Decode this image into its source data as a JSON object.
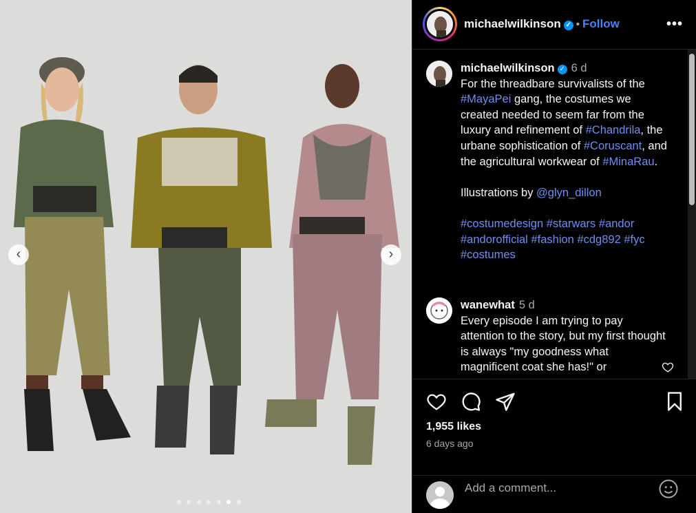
{
  "header": {
    "username": "michaelwilkinson",
    "separator": "•",
    "follow_label": "Follow",
    "more_label": "•••"
  },
  "caption": {
    "username": "michaelwilkinson",
    "time": "6 d",
    "text1": "For the threadbare survivalists of the ",
    "tag_mayapei": "#MayaPei",
    "text2": " gang, the costumes we created needed to seem far from the luxury and refinement of ",
    "tag_chandrila": "#Chandrila",
    "text3": ", the urbane sophistication of ",
    "tag_coruscant": "#Coruscant",
    "text4": ", and the agricultural workwear of ",
    "tag_minarau": "#MinaRau",
    "text5": ".",
    "illustrations_prefix": "Illustrations by ",
    "mention": "@glyn_dillon",
    "hashtags": [
      "#costumedesign",
      "#starwars",
      "#andor",
      "#andorofficial",
      "#fashion",
      "#cdg892",
      "#fyc",
      "#costumes"
    ]
  },
  "comment": {
    "username": "wanewhat",
    "time": "5 d",
    "text": "Every episode I am trying to pay attention to the story, but my first thought is always \"my goodness what magnificent coat she has!\" or"
  },
  "actions": {
    "likes": "1,955 likes",
    "time_ago": "6 days ago"
  },
  "add_comment": {
    "placeholder": "Add a comment..."
  },
  "carousel": {
    "count": 7,
    "active_index": 5
  },
  "colors": {
    "link": "#6f8ef0",
    "follow": "#4c7ff1",
    "verified": "#0095f6",
    "background": "#000000",
    "photo_bg": "#dcdcda"
  }
}
